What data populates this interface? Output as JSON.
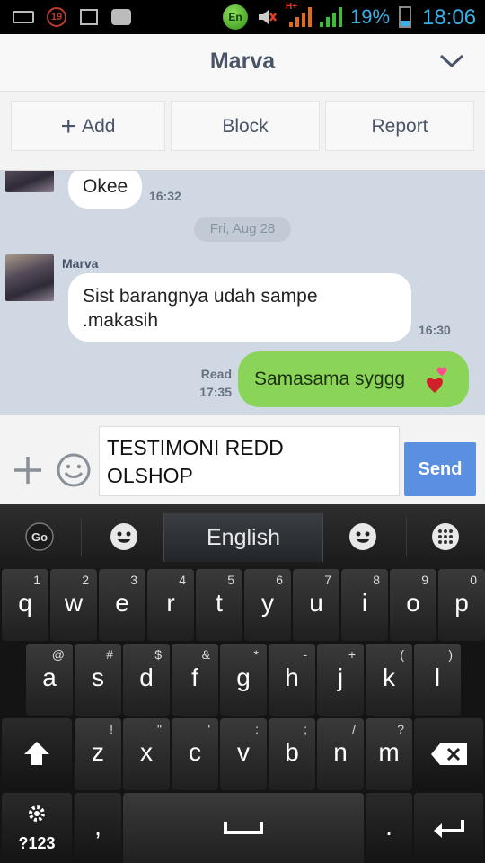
{
  "status_bar": {
    "alarm": "19",
    "lang": "En",
    "network": "H+",
    "battery": "19%",
    "time": "18:06"
  },
  "header": {
    "title": "Marva"
  },
  "actions": {
    "add": "Add",
    "block": "Block",
    "report": "Report"
  },
  "chat": {
    "messages": [
      {
        "from": "them",
        "text": "Okee",
        "time": "16:32"
      },
      {
        "from": "them",
        "sender": "Marva",
        "text": "Sist barangnya udah sampe\n.makasih",
        "time": "16:30"
      },
      {
        "from": "me",
        "text": "Samasama syggg",
        "status": "Read",
        "time": "17:35"
      }
    ],
    "date_divider": "Fri, Aug 28"
  },
  "composer": {
    "value": "TESTIMONI REDD\nOLSHOP",
    "send_label": "Send"
  },
  "keyboard": {
    "language": "English",
    "row1": [
      [
        "q",
        "1"
      ],
      [
        "w",
        "2"
      ],
      [
        "e",
        "3"
      ],
      [
        "r",
        "4"
      ],
      [
        "t",
        "5"
      ],
      [
        "y",
        "6"
      ],
      [
        "u",
        "7"
      ],
      [
        "i",
        "8"
      ],
      [
        "o",
        "9"
      ],
      [
        "p",
        "0"
      ]
    ],
    "row2": [
      [
        "a",
        "@"
      ],
      [
        "s",
        "#"
      ],
      [
        "d",
        "$"
      ],
      [
        "f",
        "&"
      ],
      [
        "g",
        "*"
      ],
      [
        "h",
        "-"
      ],
      [
        "j",
        "+"
      ],
      [
        "k",
        "("
      ],
      [
        "l",
        ")"
      ]
    ],
    "row3": [
      [
        "z",
        "!"
      ],
      [
        "x",
        "\""
      ],
      [
        "c",
        "'"
      ],
      [
        "v",
        ":"
      ],
      [
        "b",
        ";"
      ],
      [
        "n",
        "/"
      ],
      [
        "m",
        "?"
      ]
    ],
    "symbols_label": "?123",
    "comma": ",",
    "period": "."
  },
  "colors": {
    "accent_send": "#5b8fe0",
    "my_bubble": "#8ad558",
    "chat_bg": "#cfd8e3"
  }
}
